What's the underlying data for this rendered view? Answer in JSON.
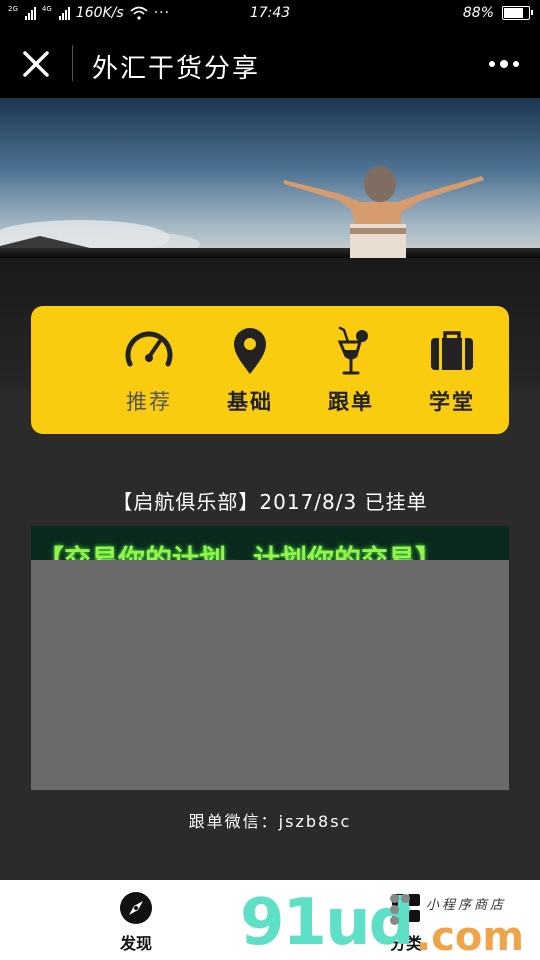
{
  "status_bar": {
    "net_tag_1": "2G",
    "net_tag_2": "4G",
    "speed": "160K/s",
    "time": "17:43",
    "battery": "88%",
    "battery_level": 0.88
  },
  "header": {
    "title": "外汇干货分享"
  },
  "menu": {
    "items": [
      {
        "label": "推荐",
        "icon": "speedometer-icon",
        "active": true
      },
      {
        "label": "基础",
        "icon": "location-pin-icon",
        "active": false
      },
      {
        "label": "跟单",
        "icon": "cocktail-icon",
        "active": false
      },
      {
        "label": "学堂",
        "icon": "briefcase-icon",
        "active": false
      }
    ]
  },
  "article": {
    "title": "【启航俱乐部】2017/8/3 已挂单",
    "image_banner_text": "【交易你的计划，计划你的交易】",
    "contact": "跟单微信：jszb8sc"
  },
  "bottom_nav": {
    "tabs": [
      {
        "label": "发现",
        "icon": "compass-icon"
      },
      {
        "label": "分类",
        "icon": "category-icon"
      }
    ]
  },
  "watermark": {
    "brand": "91ud",
    "suffix": ".com",
    "tagline": "小程序商店"
  },
  "colors": {
    "accent": "#f9cc10",
    "background": "#2b2b2b",
    "header": "#000000"
  }
}
